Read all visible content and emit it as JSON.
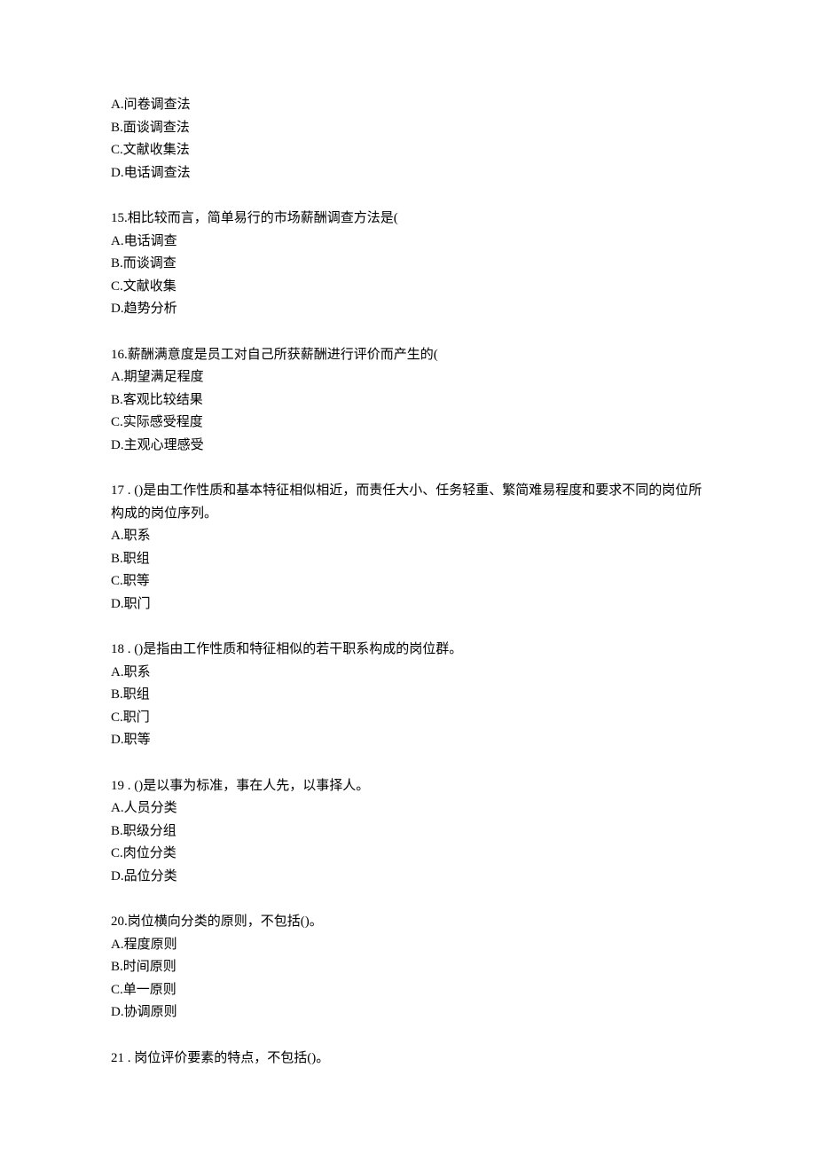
{
  "blocks": [
    {
      "lines": [
        "A.问卷调查法",
        "B.面谈调查法",
        "C.文献收集法",
        "D.电话调查法"
      ]
    },
    {
      "lines": [
        "15.相比较而言，简单易行的市场薪酬调查方法是(",
        "A.电话调查",
        "B.而谈调查",
        "C.文献收集",
        "D.趋势分析"
      ]
    },
    {
      "lines": [
        "16.薪酬满意度是员工对自己所获薪酬进行评价而产生的(",
        "A.期望满足程度",
        "B.客观比较结果",
        "C.实际感受程度",
        "D.主观心理感受"
      ]
    },
    {
      "lines": [
        "17 . ()是由工作性质和基本特征相似相近，而责任大小、任务轻重、繁简难易程度和要求不同的岗位所构成的岗位序列。",
        "A.职系",
        "B.职组",
        "C.职等",
        "D.职门"
      ]
    },
    {
      "lines": [
        "18 . ()是指由工作性质和特征相似的若干职系构成的岗位群。",
        "A.职系",
        "B.职组",
        "C.职门",
        "D.职等"
      ]
    },
    {
      "lines": [
        "19 . ()是以事为标准，事在人先，以事择人。",
        "A.人员分类",
        "B.职级分组",
        "C.肉位分类",
        "D.品位分类"
      ]
    },
    {
      "lines": [
        "20.岗位横向分类的原则，不包括()。",
        "A.程度原则",
        "B.时间原则",
        "C.单一原则",
        "D.协调原则"
      ]
    },
    {
      "lines": [
        "21 . 岗位评价要素的特点，不包括()。"
      ]
    }
  ]
}
